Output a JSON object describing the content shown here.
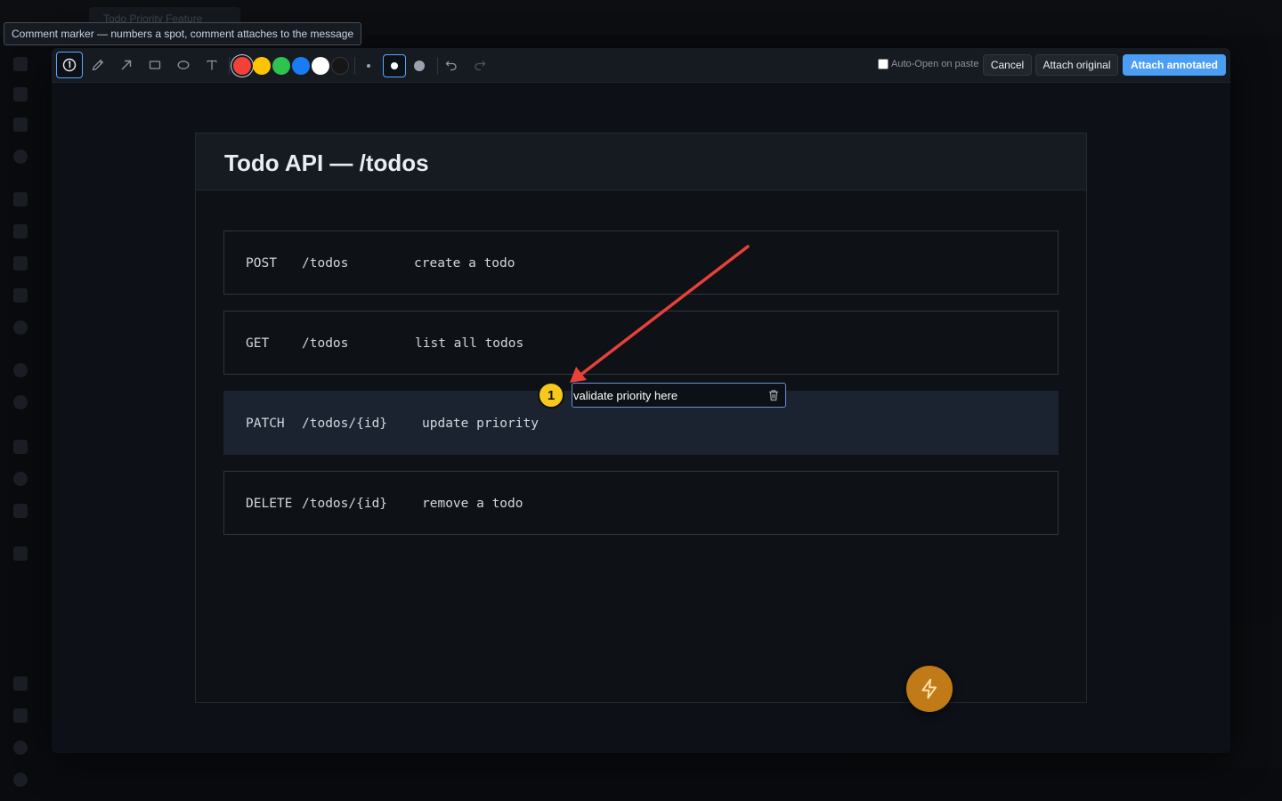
{
  "background_app": {
    "tab_title": "Todo Priority Feature"
  },
  "tooltip": {
    "text": "Comment marker — numbers a spot, comment attaches to the message"
  },
  "toolbar": {
    "tools": [
      {
        "name": "comment-marker",
        "icon": "numbered-marker-icon",
        "active": true
      },
      {
        "name": "pen",
        "icon": "pencil-icon"
      },
      {
        "name": "arrow",
        "icon": "arrow-icon"
      },
      {
        "name": "rectangle",
        "icon": "rectangle-icon"
      },
      {
        "name": "ellipse",
        "icon": "ellipse-icon"
      },
      {
        "name": "text",
        "icon": "text-icon"
      }
    ],
    "colors": [
      "#f5403a",
      "#ffc400",
      "#2ec24f",
      "#1a7cf5",
      "#ffffff",
      "#161616"
    ],
    "selected_color": "#f5403a",
    "stroke_sizes": [
      "small",
      "medium",
      "large"
    ],
    "selected_stroke_size": "medium",
    "undo_icon": "undo-icon",
    "redo_icon": "redo-icon",
    "auto_open_label": "Auto-Open on paste",
    "auto_open_checked": false,
    "cancel_label": "Cancel",
    "attach_original_label": "Attach original",
    "attach_annotated_label": "Attach annotated"
  },
  "page": {
    "title": "Todo API — /todos",
    "endpoints": [
      {
        "method": "POST",
        "path": "/todos",
        "description": "create a todo"
      },
      {
        "method": "GET",
        "path": "/todos",
        "description": "list all todos"
      },
      {
        "method": "PATCH",
        "path": "/todos/{id}",
        "description": "update priority",
        "highlighted": true
      },
      {
        "method": "DELETE",
        "path": "/todos/{id}",
        "description": "remove a todo"
      }
    ]
  },
  "annotation": {
    "marker_number": "1",
    "marker_color": "#f8c81c",
    "comment_text": "validate priority here",
    "arrow_color": "#e8403a"
  },
  "fab": {
    "icon": "lightning-icon",
    "color": "#c07a17"
  }
}
